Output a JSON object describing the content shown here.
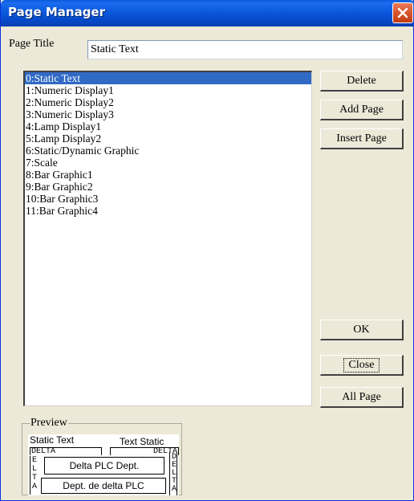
{
  "window": {
    "title": "Page Manager",
    "close_icon": "close-x-icon"
  },
  "page_title": {
    "label": "Page Title",
    "value": "Static Text"
  },
  "pages": [
    "0:Static Text",
    "1:Numeric Display1",
    "2:Numeric Display2",
    "3:Numeric Display3",
    "4:Lamp Display1",
    "5:Lamp Display2",
    "6:Static/Dynamic Graphic",
    "7:Scale",
    "8:Bar Graphic1",
    "9:Bar Graphic2",
    "10:Bar Graphic3",
    "11:Bar Graphic4"
  ],
  "selected_index": 0,
  "buttons": {
    "delete": "Delete",
    "add_page": "Add Page",
    "insert_page": "Insert Page",
    "ok": "OK",
    "close": "Close",
    "all_page": "All Page"
  },
  "preview": {
    "legend": "Preview",
    "left_caption": "Static Text",
    "right_caption": "Text Static",
    "top_left_box": "DELTA",
    "top_right_box": "DELTA",
    "center_box": "Delta PLC Dept.",
    "bottom_box": "Dept. de delta PLC",
    "left_vertical": [
      "E",
      "L",
      "T",
      "A"
    ],
    "right_vertical": [
      "D",
      "E",
      "L",
      "T",
      "A"
    ]
  },
  "colors": {
    "titlebar": "#0a5bd8",
    "selection": "#316ac5",
    "window_bg": "#ece9d8"
  }
}
